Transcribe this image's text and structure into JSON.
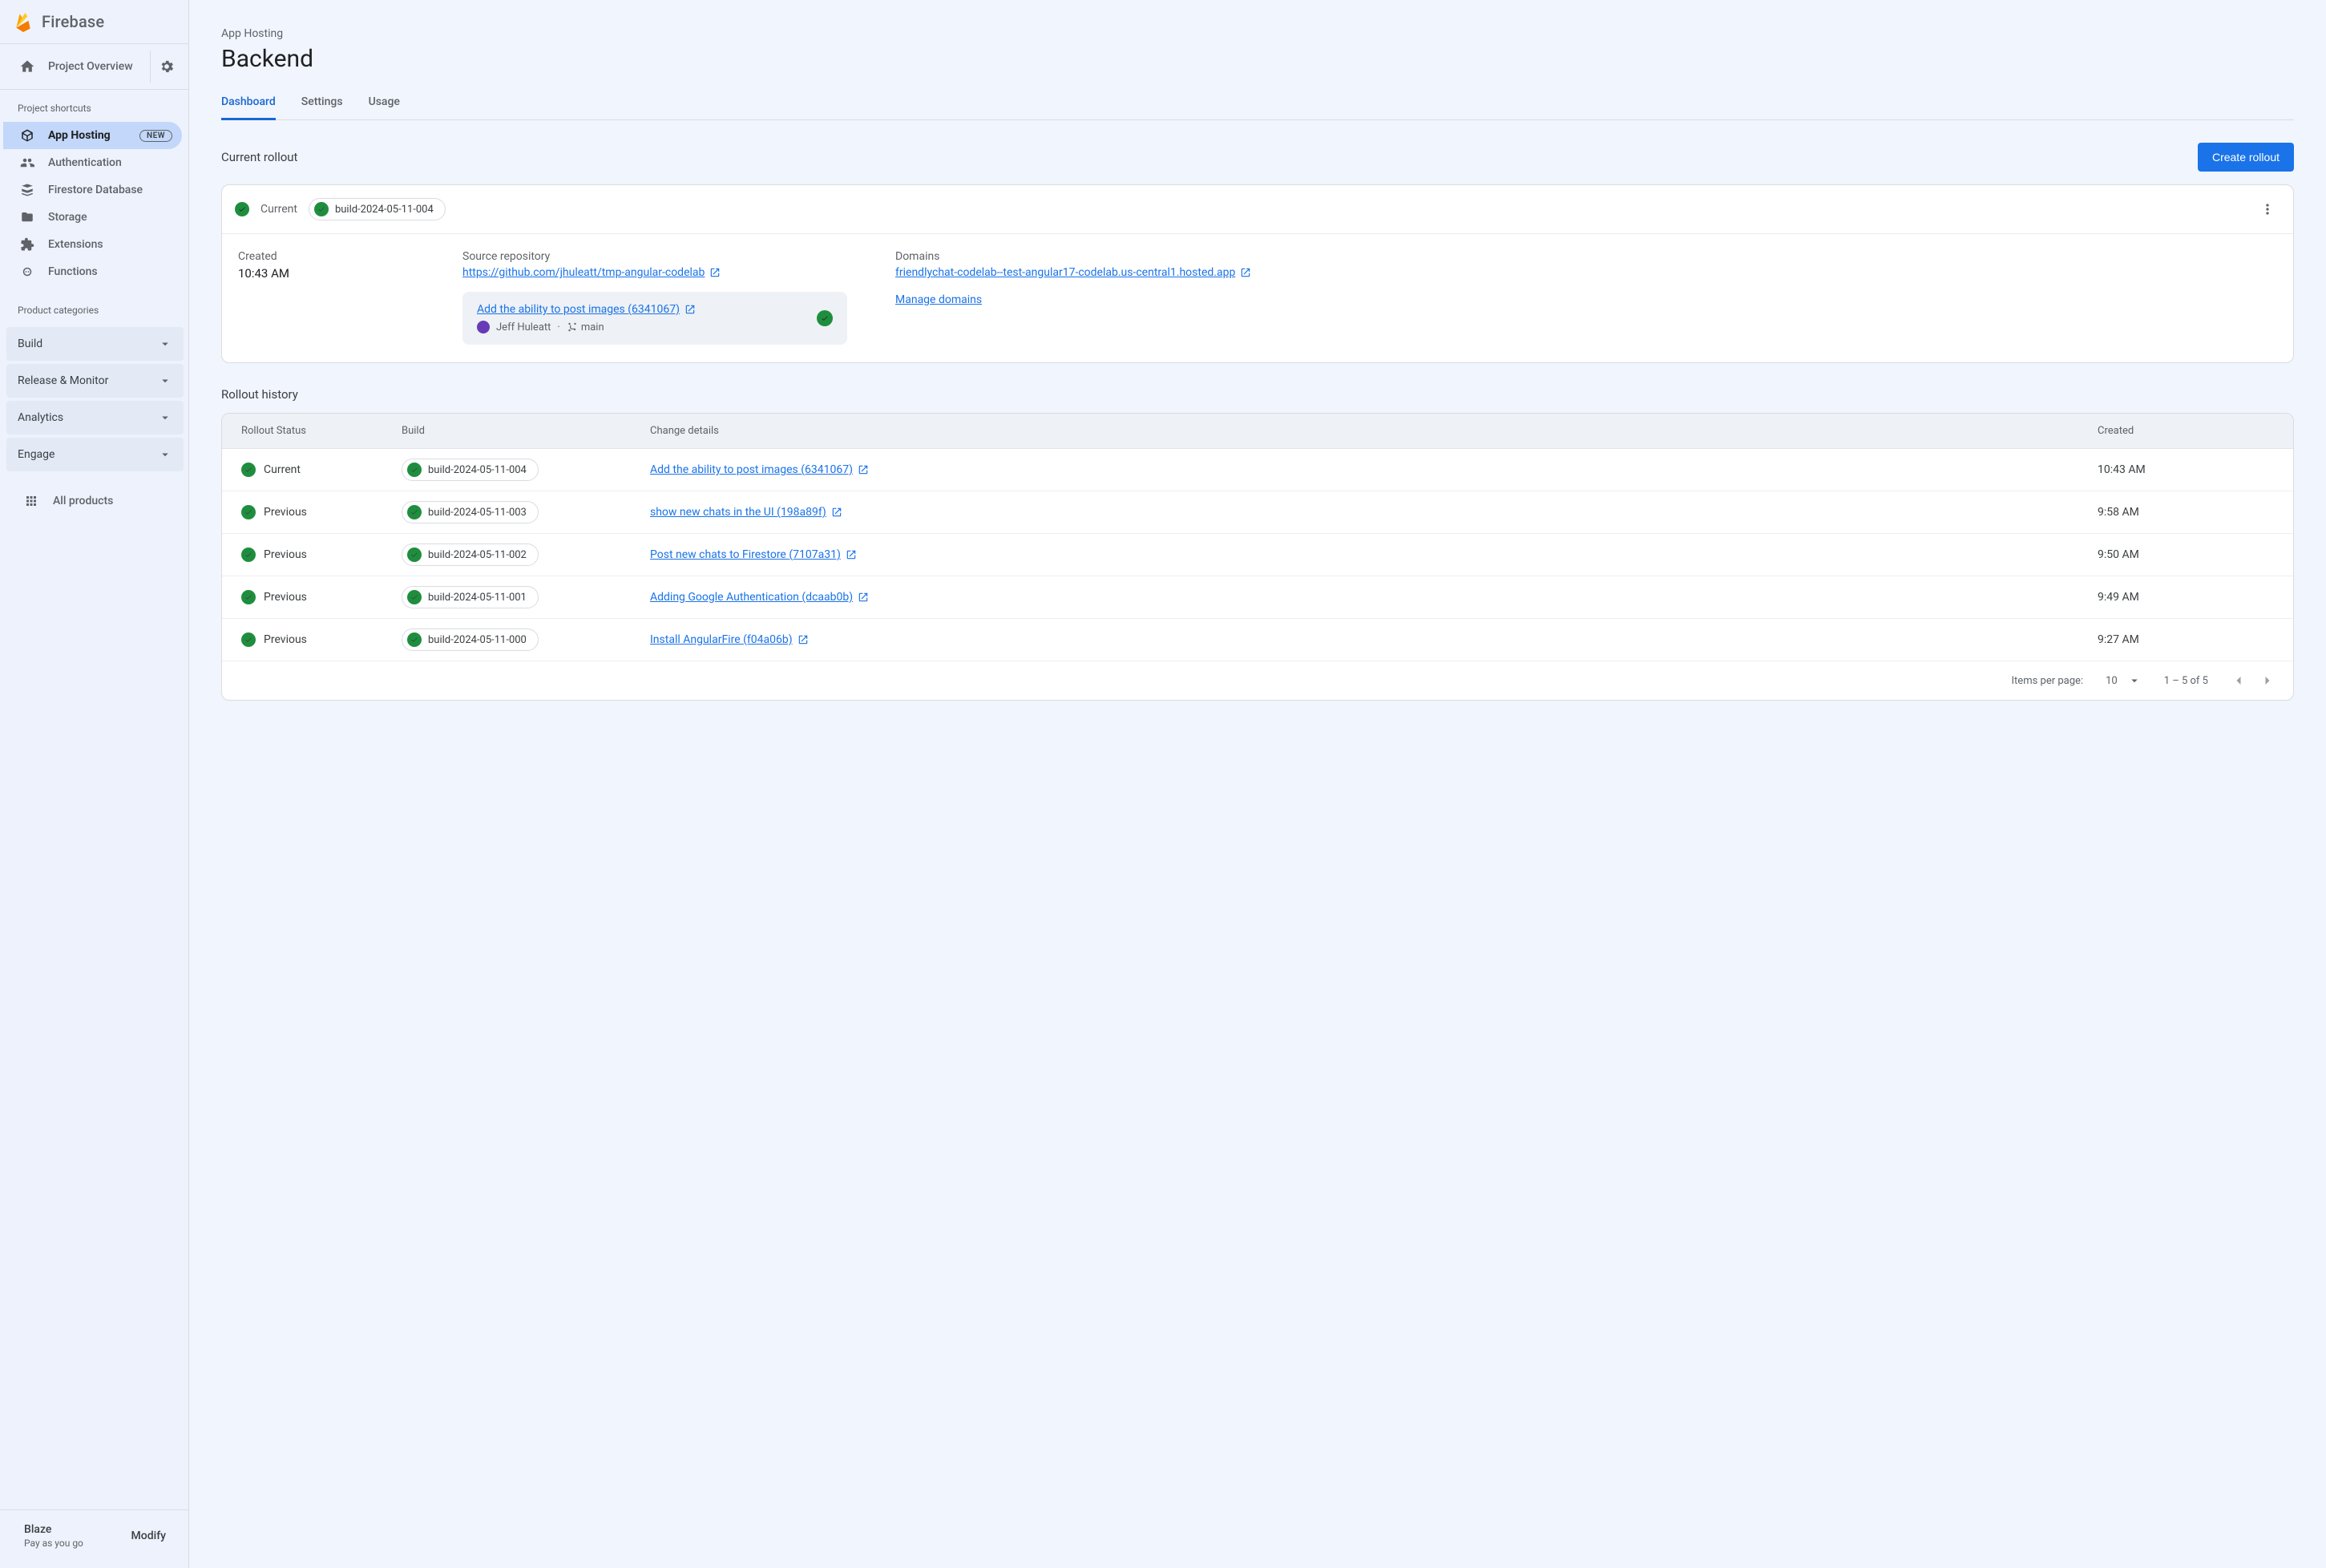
{
  "brand": {
    "name": "Firebase"
  },
  "projectOverviewLabel": "Project Overview",
  "shortcutsHeader": "Project shortcuts",
  "badgeNew": "NEW",
  "shortcuts": [
    {
      "id": "app-hosting",
      "label": "App Hosting"
    },
    {
      "id": "authentication",
      "label": "Authentication"
    },
    {
      "id": "firestore",
      "label": "Firestore Database"
    },
    {
      "id": "storage",
      "label": "Storage"
    },
    {
      "id": "extensions",
      "label": "Extensions"
    },
    {
      "id": "functions",
      "label": "Functions"
    }
  ],
  "categoriesHeader": "Product categories",
  "categories": [
    {
      "label": "Build"
    },
    {
      "label": "Release & Monitor"
    },
    {
      "label": "Analytics"
    },
    {
      "label": "Engage"
    }
  ],
  "allProducts": "All products",
  "plan": {
    "name": "Blaze",
    "sub": "Pay as you go",
    "modify": "Modify"
  },
  "page": {
    "breadcrumb": "App Hosting",
    "title": "Backend",
    "tabs": [
      "Dashboard",
      "Settings",
      "Usage"
    ]
  },
  "current": {
    "sectionTitle": "Current rollout",
    "createButton": "Create rollout",
    "statusLabel": "Current",
    "buildId": "build-2024-05-11-004",
    "createdLabel": "Created",
    "createdAt": "10:43 AM",
    "sourceLabel": "Source repository",
    "sourceUrl": "https://github.com/jhuleatt/tmp-angular-codelab",
    "domainsLabel": "Domains",
    "domain": "friendlychat-codelab--test-angular17-codelab.us-central1.hosted.app",
    "commitTitle": "Add the ability to post images (6341067)",
    "author": "Jeff Huleatt",
    "branch": "main",
    "manageDomains": "Manage domains"
  },
  "history": {
    "sectionTitle": "Rollout history",
    "columns": {
      "status": "Rollout Status",
      "build": "Build",
      "change": "Change details",
      "created": "Created"
    },
    "rows": [
      {
        "status": "Current",
        "build": "build-2024-05-11-004",
        "change": "Add the ability to post images (6341067)",
        "created": "10:43 AM"
      },
      {
        "status": "Previous",
        "build": "build-2024-05-11-003",
        "change": "show new chats in the UI (198a89f)",
        "created": "9:58 AM"
      },
      {
        "status": "Previous",
        "build": "build-2024-05-11-002",
        "change": "Post new chats to Firestore (7107a31)",
        "created": "9:50 AM"
      },
      {
        "status": "Previous",
        "build": "build-2024-05-11-001",
        "change": "Adding Google Authentication (dcaab0b)",
        "created": "9:49 AM"
      },
      {
        "status": "Previous",
        "build": "build-2024-05-11-000",
        "change": "Install AngularFire (f04a06b)",
        "created": "9:27 AM"
      }
    ],
    "pager": {
      "itemsPerPageLabel": "Items per page:",
      "itemsPerPage": "10",
      "rangeLabel": "1 – 5 of 5"
    }
  }
}
